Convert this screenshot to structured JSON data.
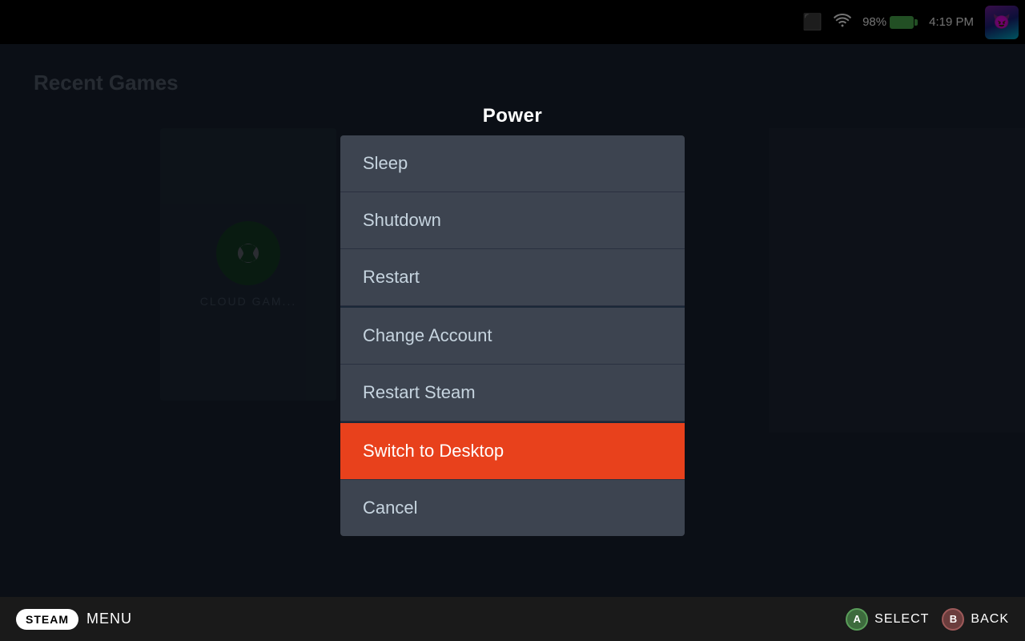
{
  "statusBar": {
    "batteryPercent": "98%",
    "time": "4:19 PM"
  },
  "background": {
    "recentGamesLabel": "Recent Games"
  },
  "dialog": {
    "title": "Power",
    "items": [
      {
        "id": "sleep",
        "label": "Sleep",
        "active": false,
        "separatorAbove": false
      },
      {
        "id": "shutdown",
        "label": "Shutdown",
        "active": false,
        "separatorAbove": false
      },
      {
        "id": "restart",
        "label": "Restart",
        "active": false,
        "separatorAbove": false
      },
      {
        "id": "change-account",
        "label": "Change Account",
        "active": false,
        "separatorAbove": true
      },
      {
        "id": "restart-steam",
        "label": "Restart Steam",
        "active": false,
        "separatorAbove": false
      },
      {
        "id": "switch-to-desktop",
        "label": "Switch to Desktop",
        "active": true,
        "separatorAbove": true
      },
      {
        "id": "cancel",
        "label": "Cancel",
        "active": false,
        "separatorAbove": false
      }
    ]
  },
  "bottomBar": {
    "steamLabel": "STEAM",
    "menuLabel": "MENU",
    "selectLabel": "SELECT",
    "backLabel": "BACK",
    "aButton": "A",
    "bButton": "B"
  }
}
